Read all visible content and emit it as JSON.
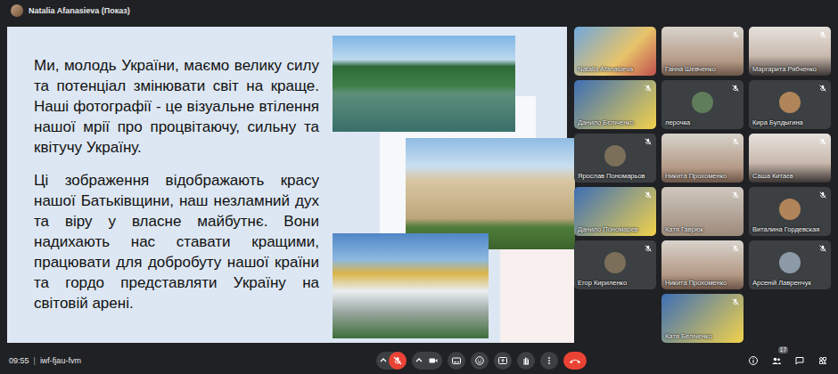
{
  "presenter": {
    "name": "Natalia Afanasieva (Показ)"
  },
  "slide": {
    "paragraphs": [
      "Ми, молодь України, маємо велику силу та потенціал змінювати світ на краще. Наші фотографії - це візуальне втілення нашої мрії про процвітаючу, сильну та квітучу Україну.",
      "Ці зображення відображають красу нашої Батьківщини, наш незламний дух та віру у власне майбутнє. Вони надихають нас ставати кращими, працювати для добробуту нашої країни та гордо представляти Україну на світовій арені."
    ]
  },
  "participants": [
    {
      "name": "Natalia Afanasieva",
      "kind": "video",
      "muted": false
    },
    {
      "name": "Ганна Шевченко",
      "kind": "video",
      "muted": true
    },
    {
      "name": "Маргарита Рябченко",
      "kind": "video",
      "muted": true
    },
    {
      "name": "Данило Бєліченко",
      "kind": "video",
      "muted": true
    },
    {
      "name": "лерочка",
      "kind": "avatar",
      "muted": true
    },
    {
      "name": "Кира Булдыгина",
      "kind": "avatar",
      "muted": true
    },
    {
      "name": "Ярослав Пономарьов",
      "kind": "avatar",
      "muted": true
    },
    {
      "name": "Никита Прохоменко",
      "kind": "video",
      "muted": true
    },
    {
      "name": "Саша Китаєв",
      "kind": "video",
      "muted": true
    },
    {
      "name": "Данило Пономарев",
      "kind": "video",
      "muted": true
    },
    {
      "name": "Катя Гаврюк",
      "kind": "video",
      "muted": true
    },
    {
      "name": "Виталина Гордевская",
      "kind": "avatar",
      "muted": true
    },
    {
      "name": "Егор Кириленко",
      "kind": "avatar",
      "muted": true
    },
    {
      "name": "Никита Прохоменко",
      "kind": "video",
      "muted": true
    },
    {
      "name": "Арсеній Лавренчук",
      "kind": "avatar",
      "muted": true
    },
    {
      "name": "Катя Беліченко",
      "kind": "video",
      "muted": true
    }
  ],
  "meeting": {
    "time": "09:55",
    "separator": "|",
    "code": "iwf-fjau-fvm"
  },
  "controls": [
    {
      "kind": "mic",
      "on": false
    },
    {
      "kind": "camera",
      "on": true
    },
    {
      "kind": "captions",
      "on": false
    },
    {
      "kind": "emoji",
      "on": false
    },
    {
      "kind": "present",
      "on": false
    },
    {
      "kind": "hand",
      "on": false
    },
    {
      "kind": "more",
      "on": false
    },
    {
      "kind": "hangup",
      "on": false
    }
  ],
  "side_controls": [
    {
      "kind": "info"
    },
    {
      "kind": "people",
      "badge": "17"
    },
    {
      "kind": "chat"
    },
    {
      "kind": "activities"
    }
  ]
}
